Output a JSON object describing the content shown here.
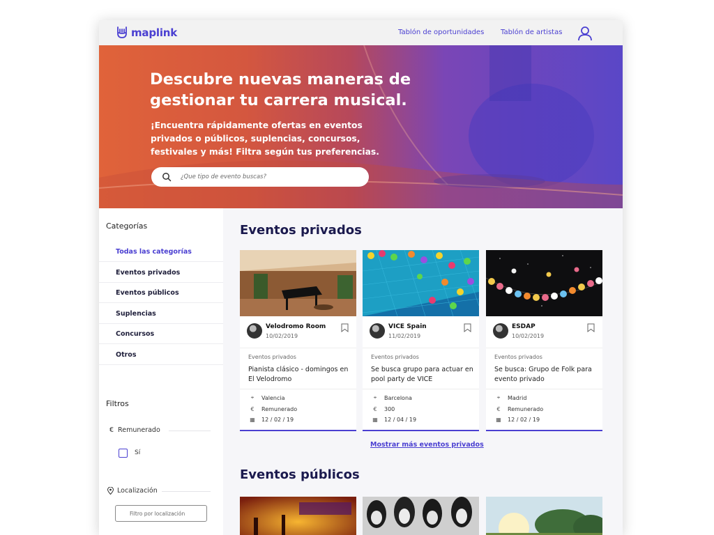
{
  "header": {
    "brand": "maplink",
    "nav": [
      "Tablón de oportunidades",
      "Tablón de artistas"
    ]
  },
  "hero": {
    "title": "Descubre nuevas maneras de gestionar tu carrera musical.",
    "subtitle": "¡Encuentra rápidamente ofertas en eventos privados o públicos, suplencias, concursos, festivales y más! Filtra según tus preferencias.",
    "search_placeholder": "¿Que tipo de evento buscas?"
  },
  "sidebar": {
    "categories_title": "Categorías",
    "categories": [
      "Todas las categorías",
      "Eventos privados",
      "Eventos públicos",
      "Suplencias",
      "Concursos",
      "Otros"
    ],
    "filters_title": "Filtros",
    "filter_paid_label": "Remunerado",
    "filter_paid_option": "Sí",
    "location_label": "Localización",
    "location_placeholder": "Filtro por localización"
  },
  "private_section": {
    "title": "Eventos privados",
    "more_link": "Mostrar más eventos privados",
    "cards": [
      {
        "name": "Velodromo Room",
        "date": "10/02/2019",
        "category": "Eventos privados",
        "desc": "Pianista clásico - domingos en El Velodromo",
        "location": "Valencia",
        "pay": "Remunerado",
        "event_date": "12 / 02 / 19"
      },
      {
        "name": "VICE Spain",
        "date": "11/02/2019",
        "category": "Eventos privados",
        "desc": "Se busca grupo para actuar en pool party de VICE",
        "location": "Barcelona",
        "pay": "300",
        "event_date": "12 / 04 / 19"
      },
      {
        "name": "ESDAP",
        "date": "10/02/2019",
        "category": "Eventos privados",
        "desc": "Se busca: Grupo de Folk para evento privado",
        "location": "Madrid",
        "pay": "Remunerado",
        "event_date": "12 / 02 / 19"
      }
    ]
  },
  "public_section": {
    "title": "Eventos públicos"
  },
  "icons": {
    "location": "location-pin-icon",
    "pay": "euro-icon",
    "calendar": "calendar-icon"
  },
  "colors": {
    "brand": "#4a3fd1",
    "heading": "#1b1a4e"
  }
}
